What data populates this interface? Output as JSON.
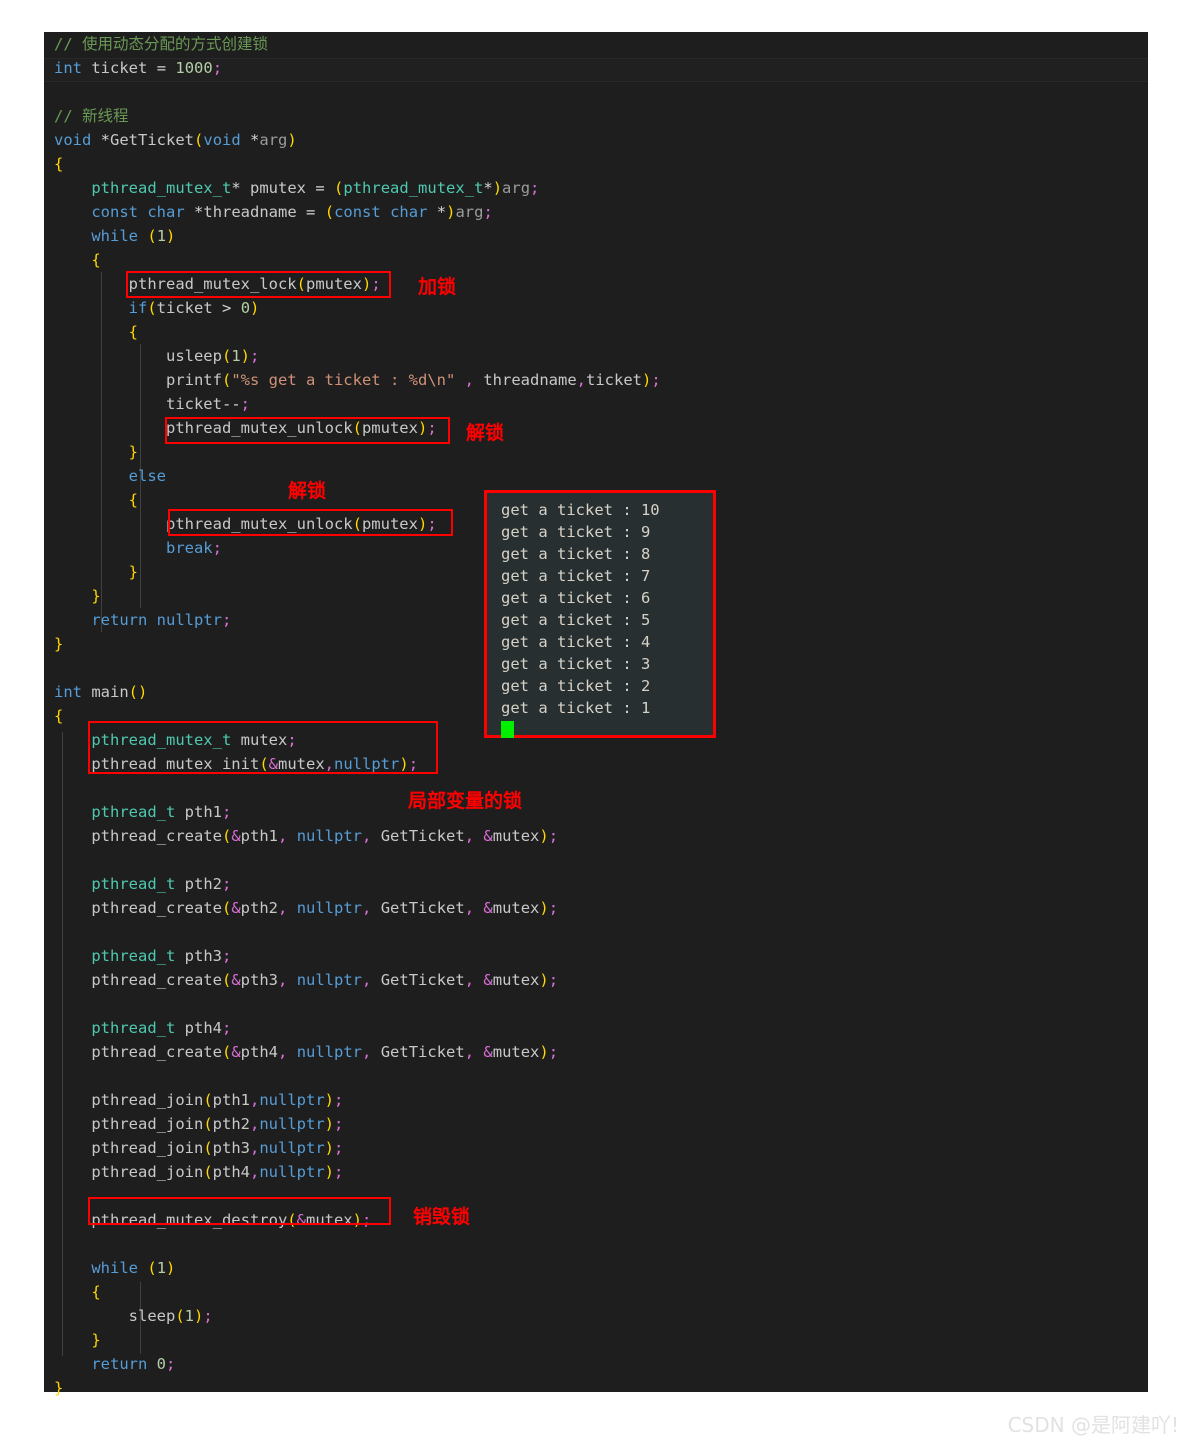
{
  "editor": {
    "theme_bg": "#1e1e1e",
    "highlight_line_index": 1,
    "code_lines": [
      "// 使用动态分配的方式创建锁",
      "int ticket = 1000;",
      "",
      "// 新线程",
      "void *GetTicket(void *arg)",
      "{",
      "    pthread_mutex_t* pmutex = (pthread_mutex_t*)arg;",
      "    const char *threadname = (const char *)arg;",
      "    while (1)",
      "    {",
      "        pthread_mutex_lock(pmutex);",
      "        if(ticket > 0)",
      "        {",
      "            usleep(1);",
      "            printf(\"%s get a ticket : %d\\n\" , threadname,ticket);",
      "            ticket--;",
      "            pthread_mutex_unlock(pmutex);",
      "        }",
      "        else",
      "        {",
      "            pthread_mutex_unlock(pmutex);",
      "            break;",
      "        }",
      "    }",
      "    return nullptr;",
      "}",
      "",
      "int main()",
      "{",
      "    pthread_mutex_t mutex;",
      "    pthread_mutex_init(&mutex,nullptr);",
      "",
      "    pthread_t pth1;",
      "    pthread_create(&pth1, nullptr, GetTicket, &mutex);",
      "",
      "    pthread_t pth2;",
      "    pthread_create(&pth2, nullptr, GetTicket, &mutex);",
      "",
      "    pthread_t pth3;",
      "    pthread_create(&pth3, nullptr, GetTicket, &mutex);",
      "",
      "    pthread_t pth4;",
      "    pthread_create(&pth4, nullptr, GetTicket, &mutex);",
      "",
      "    pthread_join(pth1,nullptr);",
      "    pthread_join(pth2,nullptr);",
      "    pthread_join(pth3,nullptr);",
      "    pthread_join(pth4,nullptr);",
      "",
      "    pthread_mutex_destroy(&mutex);",
      "",
      "    while (1)",
      "    {",
      "        sleep(1);",
      "    }",
      "    return 0;",
      "}"
    ]
  },
  "annotations": {
    "color": "#ff0000",
    "labels": [
      {
        "id": "lock-label",
        "text": "加锁"
      },
      {
        "id": "unlock-label-1",
        "text": "解锁"
      },
      {
        "id": "unlock-label-2",
        "text": "解锁"
      },
      {
        "id": "local-mutex-label",
        "text": "局部变量的锁"
      },
      {
        "id": "destroy-label",
        "text": "销毁锁"
      }
    ],
    "boxes": [
      {
        "id": "box-mutex-lock",
        "wraps": "pthread_mutex_lock(pmutex);"
      },
      {
        "id": "box-mutex-unlock-1",
        "wraps": "pthread_mutex_unlock(pmutex);"
      },
      {
        "id": "box-mutex-unlock-2",
        "wraps": "pthread_mutex_unlock(pmutex);"
      },
      {
        "id": "box-mutex-init",
        "wraps": "pthread_mutex_t mutex; pthread_mutex_init(&mutex,nullptr);"
      },
      {
        "id": "box-mutex-destroy",
        "wraps": "pthread_mutex_destroy(&mutex);"
      },
      {
        "id": "box-terminal",
        "wraps": "terminal output panel"
      }
    ]
  },
  "terminal": {
    "bg": "#272f30",
    "cursor_color": "#00ee00",
    "lines": [
      "get a ticket : 10",
      "get a ticket : 9",
      "get a ticket : 8",
      "get a ticket : 7",
      "get a ticket : 6",
      "get a ticket : 5",
      "get a ticket : 4",
      "get a ticket : 3",
      "get a ticket : 2",
      "get a ticket : 1"
    ]
  },
  "watermark": {
    "text": "CSDN @是阿建吖!"
  }
}
